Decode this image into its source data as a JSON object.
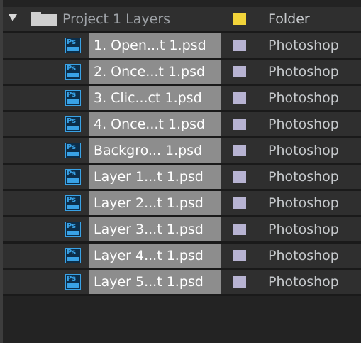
{
  "folder": {
    "name": "Project 1 Layers",
    "label_color": "#f2d43a",
    "type": "Folder",
    "expanded": true
  },
  "layers": [
    {
      "name": "1. Open...t 1.psd",
      "type": "Photoshop",
      "label_color": "#b7b3d2",
      "icon": "photoshop-file-icon"
    },
    {
      "name": "2. Once...t 1.psd",
      "type": "Photoshop",
      "label_color": "#b7b3d2",
      "icon": "photoshop-file-icon"
    },
    {
      "name": "3. Clic...ct 1.psd",
      "type": "Photoshop",
      "label_color": "#b7b3d2",
      "icon": "photoshop-file-icon"
    },
    {
      "name": "4. Once...t 1.psd",
      "type": "Photoshop",
      "label_color": "#b7b3d2",
      "icon": "photoshop-file-icon"
    },
    {
      "name": "Backgro... 1.psd",
      "type": "Photoshop",
      "label_color": "#b7b3d2",
      "icon": "photoshop-file-icon"
    },
    {
      "name": "Layer 1...t 1.psd",
      "type": "Photoshop",
      "label_color": "#b7b3d2",
      "icon": "photoshop-file-icon"
    },
    {
      "name": "Layer 2...t 1.psd",
      "type": "Photoshop",
      "label_color": "#b7b3d2",
      "icon": "photoshop-file-icon"
    },
    {
      "name": "Layer 3...t 1.psd",
      "type": "Photoshop",
      "label_color": "#b7b3d2",
      "icon": "photoshop-file-icon"
    },
    {
      "name": "Layer 4...t 1.psd",
      "type": "Photoshop",
      "label_color": "#b7b3d2",
      "icon": "photoshop-file-icon"
    },
    {
      "name": "Layer 5...t 1.psd",
      "type": "Photoshop",
      "label_color": "#b7b3d2",
      "icon": "photoshop-file-icon"
    }
  ],
  "icons": {
    "twirl": "triangle-down-icon",
    "folder": "folder-icon",
    "file": "photoshop-file-icon"
  }
}
